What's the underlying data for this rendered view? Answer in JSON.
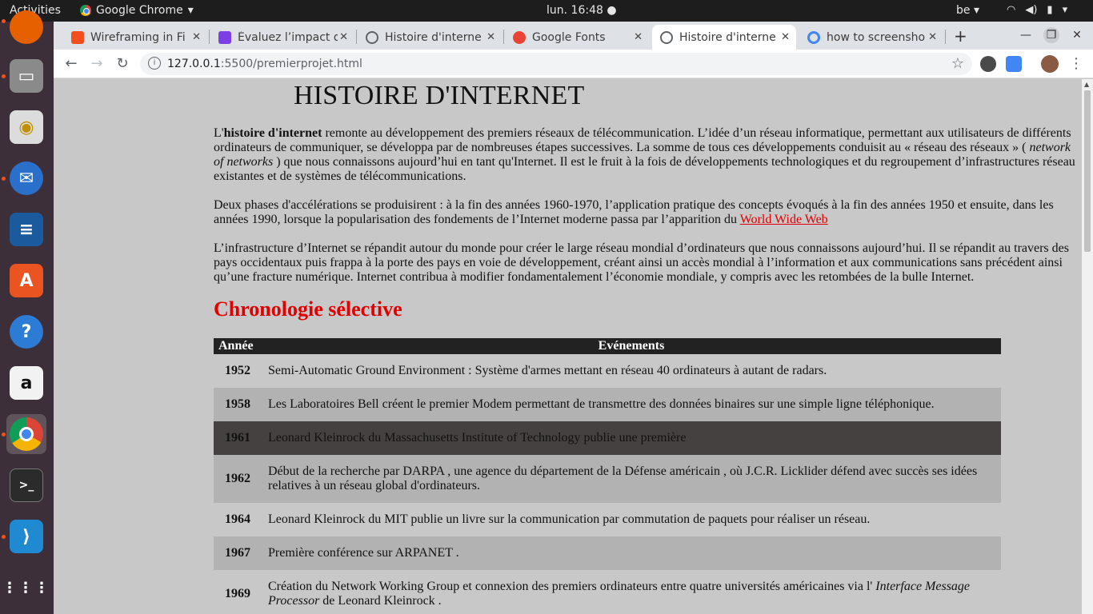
{
  "system": {
    "activities": "Activities",
    "app_name": "Google Chrome",
    "clock": "lun. 16:48",
    "keyboard_layout": "be"
  },
  "browser": {
    "tabs": [
      {
        "title": "Wireframing in Fi",
        "favicon_color": "#f24e1e"
      },
      {
        "title": "Évaluez l’impact d",
        "favicon_color": "#7b3fe4"
      },
      {
        "title": "Histoire d'interne",
        "favicon_color": "#5f6368"
      },
      {
        "title": "Google Fonts",
        "favicon_color": "#ea4335"
      },
      {
        "title": "Histoire d'interne",
        "favicon_color": "#5f6368"
      },
      {
        "title": "how to screensho",
        "favicon_color": "#4285f4"
      }
    ],
    "url_host": "127.0.0.1",
    "url_rest": ":5500/premierprojet.html"
  },
  "page": {
    "title": "HISTOIRE D'INTERNET",
    "p1_lead": "L'",
    "p1_bold": "histoire d'internet",
    "p1_a": " remonte au développement des premiers réseaux de télécommunication. L’idée d’un réseau informatique, permettant aux utilisateurs de différents ordinateurs de communiquer, se développa par de nombreuses étapes successives. La somme de tous ces développements conduisit au « réseau des réseaux » ( ",
    "p1_italic": "network of networks",
    "p1_b": " ) que nous connaissons aujourd’hui en tant qu'Internet. Il est le fruit à la fois de développements technologiques et du regroupement d’infrastructures réseau existantes et de systèmes de télécommunications.",
    "p2_text": "Deux phases d'accélérations se produisirent : à la fin des années 1960-1970, l’application pratique des concepts évoqués à la fin des années 1950 et ensuite, dans les années 1990, lorsque la popularisation des fondements de l’Internet moderne passa par l’apparition du ",
    "p2_link": "World Wide Web",
    "p3": "L’infrastructure d’Internet se répandit autour du monde pour créer le large réseau mondial d’ordinateurs que nous connaissons aujourd’hui. Il se répandit au travers des pays occidentaux puis frappa à la porte des pays en voie de développement, créant ainsi un accès mondial à l’information et aux communications sans précédent ainsi qu’une fracture numérique. Internet contribua à modifier fondamentalement l’économie mondiale, y compris avec les retombées de la bulle Internet.",
    "section_title": "Chronologie sélective",
    "table": {
      "headers": [
        "Année",
        "Evénements"
      ],
      "rows": [
        {
          "year": "1952",
          "event": "Semi-Automatic Ground Environment : Système d'armes mettant en réseau 40 ordinateurs à autant de radars."
        },
        {
          "year": "1958",
          "event": "Les Laboratoires Bell créent le premier Modem permettant de transmettre des données binaires sur une simple ligne téléphonique."
        },
        {
          "year": "1961",
          "event": "Leonard Kleinrock du Massachusetts Institute of Technology publie une première"
        },
        {
          "year": "1962",
          "event": "Début de la recherche par DARPA , une agence du département de la Défense américain , où J.C.R. Licklider défend avec succès ses idées relatives à un réseau global d'ordinateurs."
        },
        {
          "year": "1964",
          "event": "Leonard Kleinrock du MIT publie un livre sur la communication par commutation de paquets pour réaliser un réseau."
        },
        {
          "year": "1967",
          "event": "Première conférence sur ARPANET ."
        },
        {
          "year": "1969",
          "event_a": "Création du Network Working Group et connexion des premiers ordinateurs entre quatre universités américaines via l' ",
          "event_italic": "Interface Message Processor",
          "event_b": "  de Leonard Kleinrock ."
        }
      ]
    }
  }
}
